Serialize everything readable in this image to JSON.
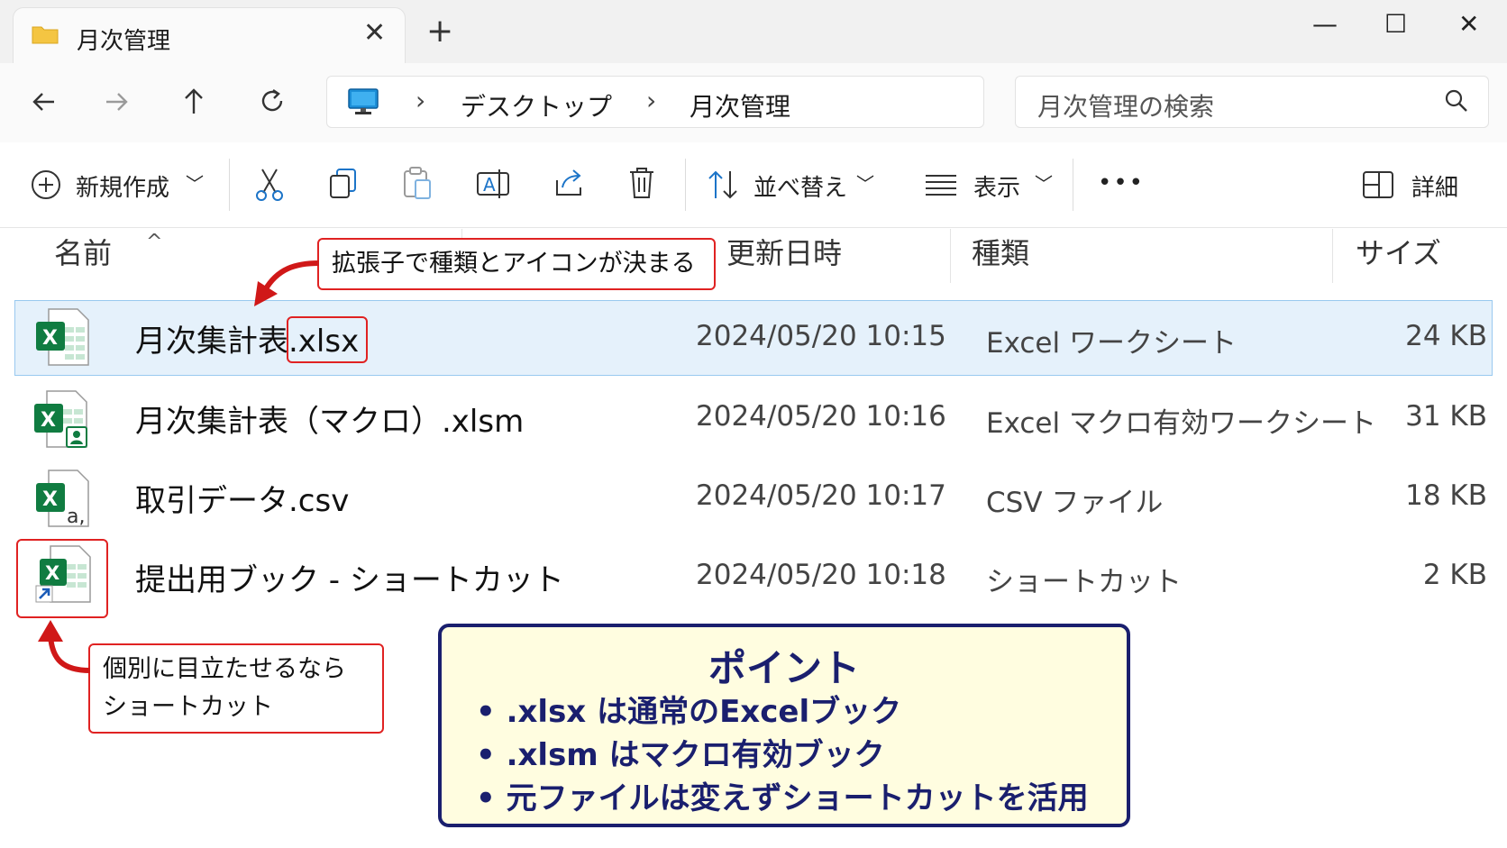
{
  "window": {
    "tab_title": "月次管理",
    "new_tab": "+",
    "close_tab": "✕",
    "minimize": "—",
    "maximize": "☐",
    "close": "✕"
  },
  "nav": {
    "breadcrumbs": [
      {
        "label": "デスクトップ"
      },
      {
        "label": "月次管理"
      }
    ],
    "search_placeholder": "月次管理の検索"
  },
  "toolbar": {
    "new_label": "新規作成",
    "sort_label": "並べ替え",
    "view_label": "表示",
    "more_label": "•••",
    "details_label": "詳細"
  },
  "columns": {
    "name": "名前",
    "date": "更新日時",
    "type": "種類",
    "size": "サイズ"
  },
  "files": [
    {
      "name": "月次集計表.xlsx",
      "date": "2024/05/20 10:15",
      "type": "Excel ワークシート",
      "size": "24 KB",
      "icon": "excel-workbook-icon",
      "selected": true
    },
    {
      "name": "月次集計表（マクロ）.xlsm",
      "date": "2024/05/20 10:16",
      "type": "Excel マクロ有効ワークシート",
      "size": "31 KB",
      "icon": "excel-macro-icon",
      "selected": false
    },
    {
      "name": "取引データ.csv",
      "date": "2024/05/20 10:17",
      "type": "CSV ファイル",
      "size": "18 KB",
      "icon": "csv-file-icon",
      "selected": false
    },
    {
      "name": "提出用ブック - ショートカット",
      "date": "2024/05/20 10:18",
      "type": "ショートカット",
      "size": "2 KB",
      "icon": "excel-shortcut-icon",
      "selected": false
    }
  ],
  "annotations": {
    "callout_ext": "拡張子で種類とアイコンが決まる",
    "callout_shortcut_line1": "個別に目立たせるなら",
    "callout_shortcut_line2": "ショートカット",
    "point_title": "ポイント",
    "point_lines": [
      "• .xlsx  は通常のExcelブック",
      "• .xlsm  はマクロ有効ブック",
      "• 元ファイルは変えずショートカットを活用"
    ]
  },
  "colors": {
    "accent_red": "#e02222",
    "excel_green": "#107c41",
    "point_navy": "#1a1f6e",
    "point_bg": "#fffde0",
    "selection_bg": "#e5f1fb"
  }
}
